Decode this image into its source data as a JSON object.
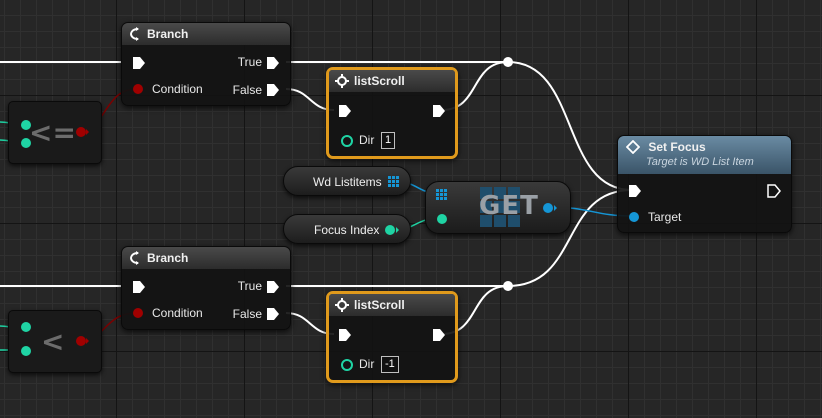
{
  "nodes": {
    "branch_top": {
      "title": "Branch",
      "true_label": "True",
      "condition_label": "Condition",
      "false_label": "False"
    },
    "branch_bottom": {
      "title": "Branch",
      "true_label": "True",
      "condition_label": "Condition",
      "false_label": "False"
    },
    "list_scroll_top": {
      "title": "listScroll",
      "dir_label": "Dir",
      "dir_value": "1"
    },
    "list_scroll_bottom": {
      "title": "listScroll",
      "dir_label": "Dir",
      "dir_value": "-1"
    },
    "set_focus": {
      "title": "Set Focus",
      "subtitle": "Target is WD List Item",
      "target_label": "Target"
    },
    "wd_listitems": {
      "label": "Wd Listitems"
    },
    "focus_index": {
      "label": "Focus Index"
    },
    "get": {
      "label": "GET"
    },
    "compare_top": {
      "symbol": "<="
    },
    "compare_bottom": {
      "symbol": "<"
    }
  },
  "colors": {
    "exec": "#ffffff",
    "bool_pin": "#8b0000",
    "int_pin": "#1fd4a4",
    "object_pin": "#00a8f0",
    "selection": "#e09a1c",
    "function_header": "#3a5468"
  }
}
